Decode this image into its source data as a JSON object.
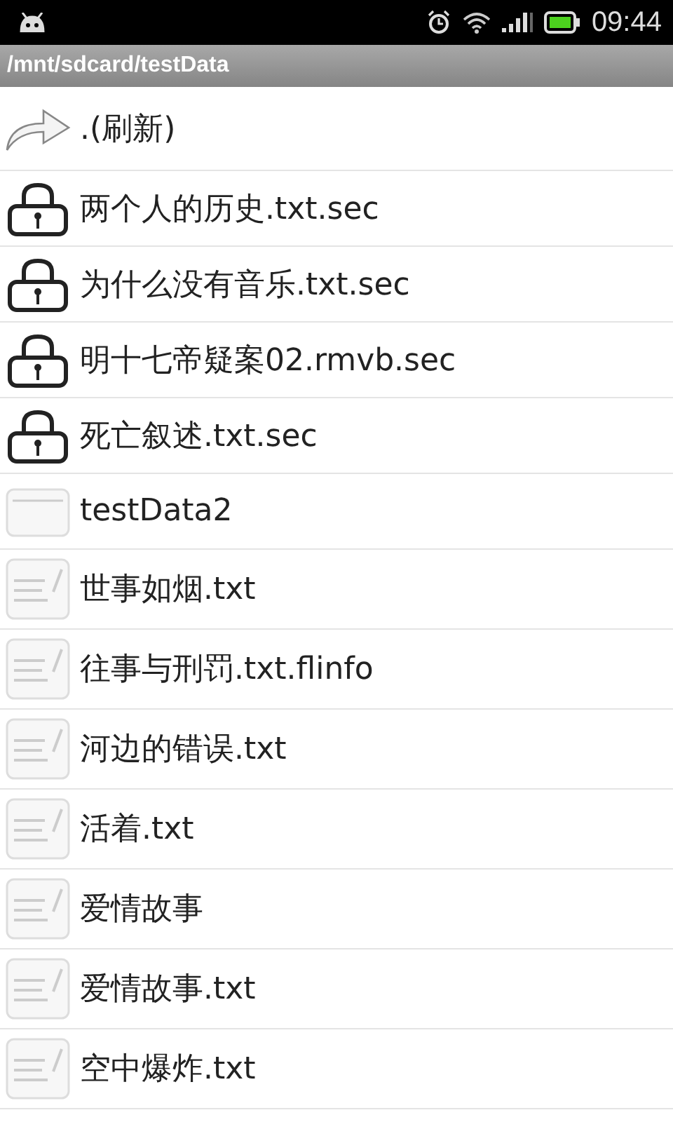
{
  "status_bar": {
    "time": "09:44"
  },
  "path_bar": {
    "path": "/mnt/sdcard/testData"
  },
  "files": [
    {
      "kind": "up",
      "name": ".(刷新)"
    },
    {
      "kind": "locked",
      "name": "两个人的历史.txt.sec"
    },
    {
      "kind": "locked",
      "name": "为什么没有音乐.txt.sec"
    },
    {
      "kind": "locked",
      "name": "明十七帝疑案02.rmvb.sec"
    },
    {
      "kind": "locked",
      "name": "死亡叙述.txt.sec"
    },
    {
      "kind": "folder",
      "name": "testData2"
    },
    {
      "kind": "file",
      "name": "世事如烟.txt"
    },
    {
      "kind": "file",
      "name": "往事与刑罚.txt.flinfo"
    },
    {
      "kind": "file",
      "name": "河边的错误.txt"
    },
    {
      "kind": "file",
      "name": "活着.txt"
    },
    {
      "kind": "file",
      "name": "爱情故事"
    },
    {
      "kind": "file",
      "name": "爱情故事.txt"
    },
    {
      "kind": "file",
      "name": "空中爆炸.txt"
    }
  ]
}
